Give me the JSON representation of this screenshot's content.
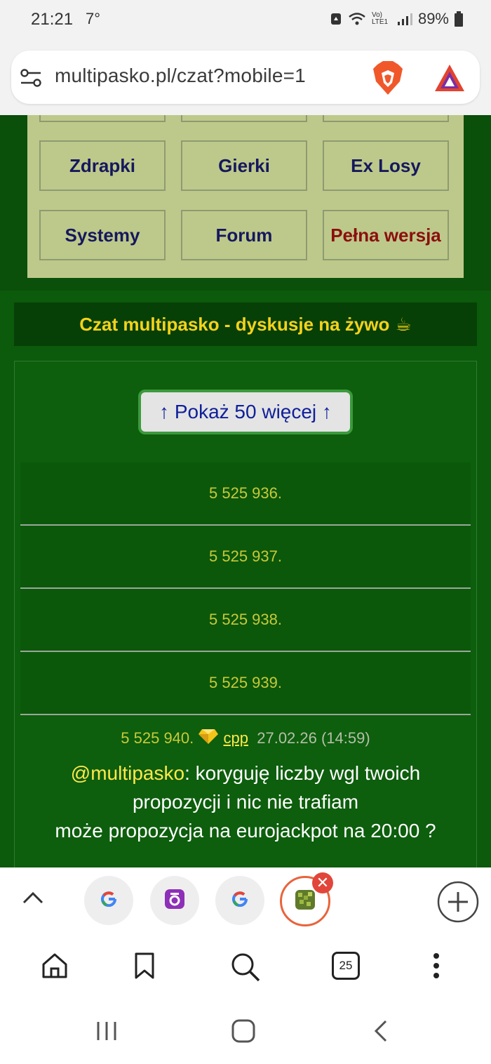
{
  "status": {
    "time": "21:21",
    "temp": "7°",
    "battery": "89%",
    "network": "Vo) LTE1"
  },
  "browser": {
    "url": "multipasko.pl/czat?mobile=1",
    "tab_count": "25"
  },
  "menu": {
    "row1": [
      "Zdrapki",
      "Gierki",
      "Ex Losy"
    ],
    "row2": [
      "Systemy",
      "Forum",
      "Pełna wersja"
    ]
  },
  "chat": {
    "header": "Czat multipasko - dyskusje na żywo",
    "header_emoji": "☕",
    "show_more": "↑ Pokaż 50 więcej ↑",
    "rows": [
      "5 525 936.",
      "5 525 937.",
      "5 525 938.",
      "5 525 939."
    ],
    "message": {
      "number": "5 525 940.",
      "user": "cpp",
      "date": "27.02.26 (14:59)",
      "mention": "@multipasko",
      "text_line1": ": koryguję liczby wgl twoich",
      "text_line2": "propozycji i nic nie trafiam",
      "text_line3": "może propozycja na eurojackpot na 20:00 ?"
    }
  },
  "colors": {
    "page_bg": "#0c5a0c",
    "menu_bg": "#bdc98a",
    "header_text": "#f4d21d",
    "accent": "#e8643c"
  }
}
